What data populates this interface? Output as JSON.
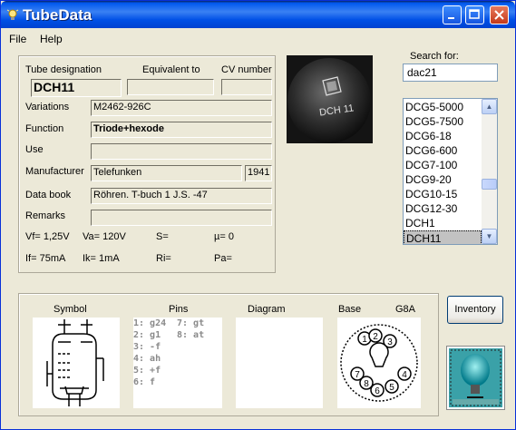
{
  "window": {
    "title": "TubeData"
  },
  "menu": {
    "file": "File",
    "help": "Help"
  },
  "headers": {
    "designation": "Tube designation",
    "equivalent": "Equivalent to",
    "cv": "CV number"
  },
  "tube": {
    "designation": "DCH11",
    "equivalent": "",
    "cv": "",
    "variations": "M2462-926C",
    "function": "Triode+hexode",
    "use": "",
    "manufacturer": "Telefunken",
    "year": "1941",
    "databook": "Röhren. T-buch 1 J.S. -47",
    "remarks": ""
  },
  "labels": {
    "variations": "Variations",
    "function": "Function",
    "use": "Use",
    "manufacturer": "Manufacturer",
    "databook": "Data book",
    "remarks": "Remarks"
  },
  "params": {
    "vf": "Vf= 1,25V",
    "va": "Va= 120V",
    "s": "S=",
    "mu": "µ=   0",
    "if": "If= 75mA",
    "ik": "Ik=   1mA",
    "ri": "Ri=",
    "pa": "Pa="
  },
  "photo": {
    "marking": "DCH 11"
  },
  "search": {
    "label": "Search for:",
    "value": "dac21"
  },
  "tubelist": [
    "DCG5-5000",
    "DCG5-7500",
    "DCG6-18",
    "DCG6-600",
    "DCG7-100",
    "DCG9-20",
    "DCG10-15",
    "DCG12-30",
    "DCH1",
    "DCH11"
  ],
  "selected_index": 9,
  "bottom": {
    "symbol": "Symbol",
    "pins": "Pins",
    "diagram": "Diagram",
    "base": "Base",
    "base_type": "G8A",
    "pin_list_left": [
      "1: g24",
      "2: g1",
      "3: -f",
      "4: ah",
      "5: +f",
      "6: f"
    ],
    "pin_list_right": [
      "7: gt",
      "8: at"
    ],
    "base_pin_numbers": [
      "1",
      "2",
      "3",
      "4",
      "5",
      "6",
      "7",
      "8"
    ]
  },
  "buttons": {
    "inventory": "Inventory"
  },
  "colors": {
    "titlebar": "#0058ee",
    "face": "#ece9d8",
    "selection": "#c2c2c2"
  }
}
